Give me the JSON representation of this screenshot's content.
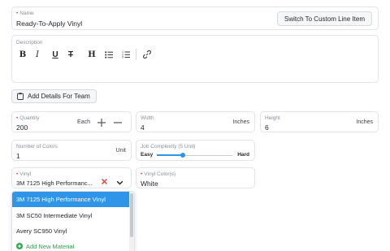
{
  "name_field": {
    "label": "Name",
    "value": "Ready-To-Apply Vinyl",
    "switch_label": "Switch To Custom Line Item"
  },
  "description": {
    "label": "Description"
  },
  "toolbar": {
    "bold": "B",
    "italic": "I",
    "underline": "U",
    "strike": "T",
    "heading": "H"
  },
  "add_details_label": "Add Details For Team",
  "quantity": {
    "label": "Quantity",
    "value": "200",
    "unit": "Each"
  },
  "width": {
    "label": "Width",
    "value": "4",
    "unit": "Inches"
  },
  "height": {
    "label": "Height",
    "value": "6",
    "unit": "Inches"
  },
  "colors": {
    "label": "Number of Colors",
    "value": "1",
    "unit": "Unit"
  },
  "complexity": {
    "label": "Job Complexity (5 Unit)",
    "min_label": "Easy",
    "max_label": "Hard",
    "level": 0.33
  },
  "vinyl": {
    "label": "Vinyl",
    "value": "3M 7125 High Performanc..."
  },
  "vinyl_color": {
    "label": "Vinyl Color(s)",
    "value": "White"
  },
  "dropdown": {
    "options": [
      "3M 7125 High Performance Vinyl",
      "3M SC50 Intermediate Vinyl",
      "Avery SC950 Vinyl"
    ],
    "add_label": "Add New Material"
  },
  "colors_theme": {
    "accent": "#2f95e9",
    "required": "#e0413c",
    "add_green": "#2ea44f"
  }
}
